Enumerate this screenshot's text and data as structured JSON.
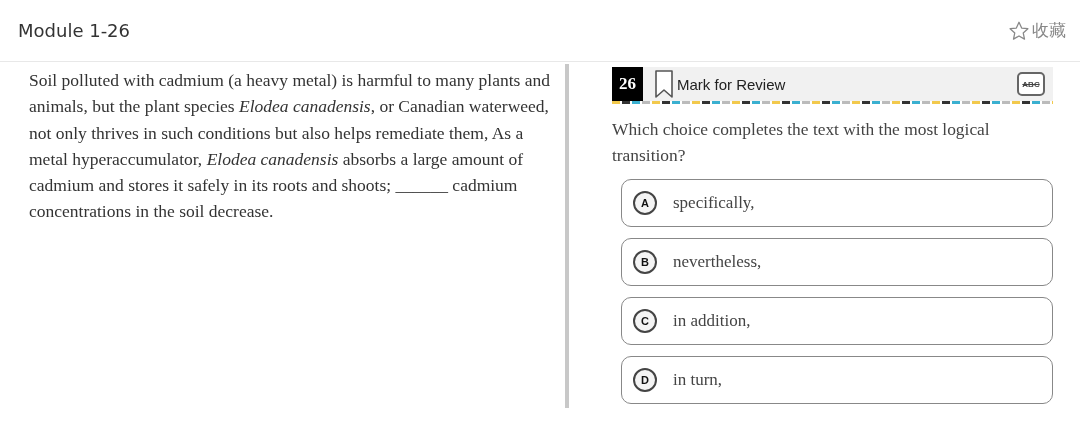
{
  "header": {
    "title": "Module 1-26",
    "favorite": {
      "label": "收藏",
      "on": false
    }
  },
  "passage": "Soil polluted with cadmium (a heavy metal) is harmful to many plants and animals, but the plant species *Elodea canadensis*, or Canadian waterweed, not only thrives in such conditions but also helps remediate them, As a metal hyperaccumulator, *Elodea canadensis* absorbs a large amount of cadmium and stores it safely in its roots and shoots; ______ cadmium concentrations in the soil decrease.",
  "question": {
    "number": "26",
    "mark_for_review": {
      "label": "Mark for Review",
      "marked": false
    },
    "eliminator": "ABC",
    "prompt": "Which choice completes the text with the most logical transition?",
    "choices": [
      {
        "letter": "A",
        "text": "specifically,",
        "selected": false
      },
      {
        "letter": "B",
        "text": "nevertheless,",
        "selected": false
      },
      {
        "letter": "C",
        "text": "in addition,",
        "selected": false
      },
      {
        "letter": "D",
        "text": "in turn,",
        "selected": false
      }
    ]
  }
}
